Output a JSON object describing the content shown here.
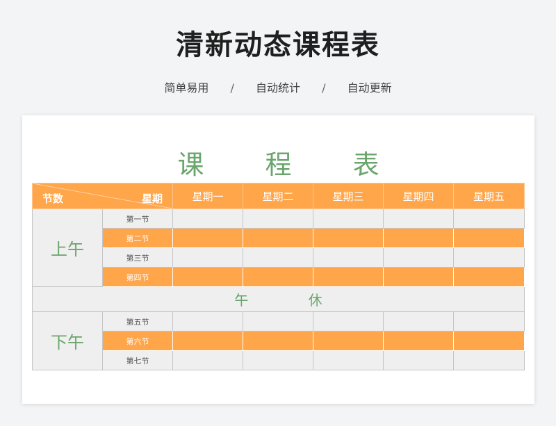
{
  "header": {
    "title": "清新动态课程表",
    "features": [
      "简单易用",
      "自动统计",
      "自动更新"
    ],
    "separator": "/"
  },
  "sheet": {
    "title": "课 程 表",
    "corner_left": "节数",
    "corner_right": "星期",
    "days": [
      "星期一",
      "星期二",
      "星期三",
      "星期四",
      "星期五"
    ],
    "morning_label": "上午",
    "afternoon_label": "下午",
    "lunch_label": "午 休",
    "morning_periods": [
      "第一节",
      "第二节",
      "第三节",
      "第四节"
    ],
    "afternoon_periods": [
      "第五节",
      "第六节",
      "第七节"
    ]
  },
  "colors": {
    "accent": "#ffa54a",
    "green": "#6aa56d",
    "gray": "#efefef"
  }
}
